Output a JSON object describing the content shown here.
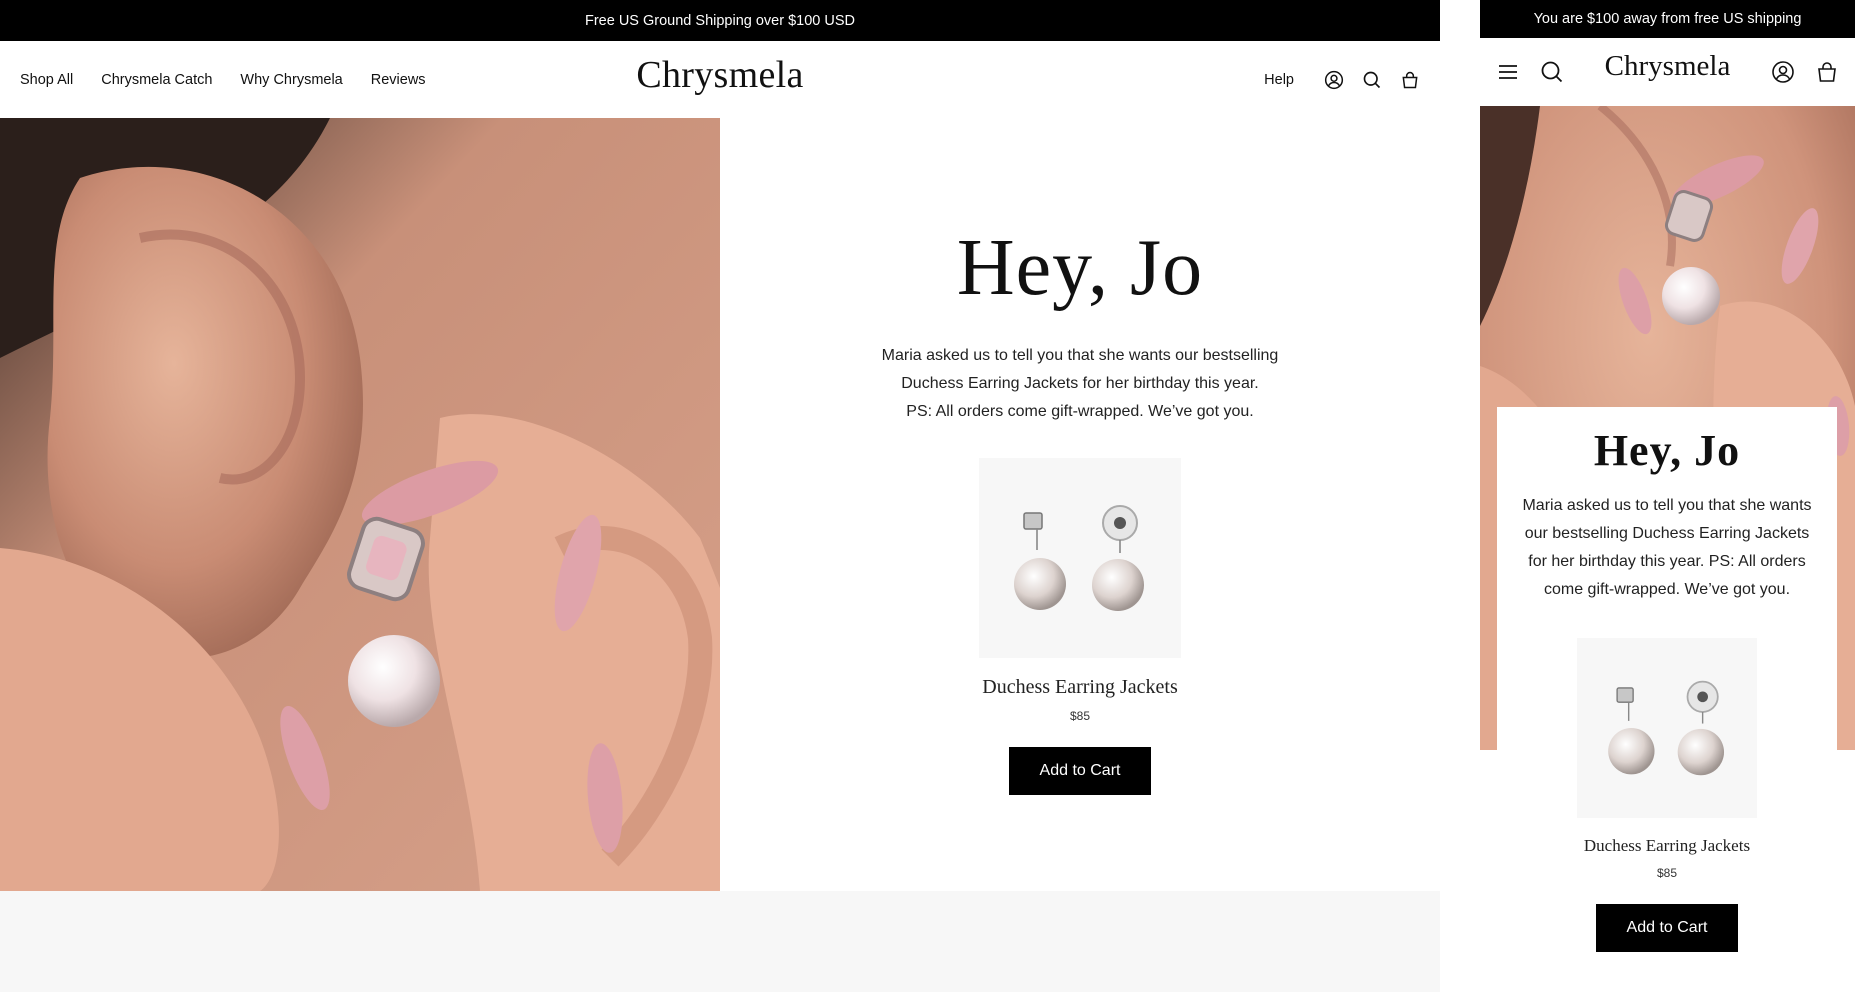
{
  "desktop": {
    "announcement": "Free US Ground Shipping over $100 USD",
    "nav": [
      "Shop All",
      "Chrysmela Catch",
      "Why Chrysmela",
      "Reviews"
    ],
    "logo": "Chrysmela",
    "help": "Help",
    "hero": {
      "greeting": "Hey, Jo",
      "message_lines": [
        "Maria asked us to tell you that she wants our bestselling",
        "Duchess Earring Jackets for her birthday this year.",
        "PS: All orders come gift-wrapped. We’ve got you."
      ],
      "product_name": "Duchess Earring Jackets",
      "price": "$85",
      "cta": "Add to Cart"
    }
  },
  "mobile": {
    "announcement": "You are $100 away from free US shipping",
    "logo": "Chrysmela",
    "greeting": "Hey, Jo",
    "message": "Maria asked us to tell you that she wants our bestselling Duchess Earring Jackets for her birthday this year. PS: All orders come gift-wrapped. We’ve got you.",
    "product_name": "Duchess Earring Jackets",
    "price": "$85",
    "cta": "Add to Cart"
  },
  "icons": {
    "account": "account-icon",
    "search": "search-icon",
    "cart": "bag-icon",
    "menu": "hamburger-menu-icon"
  },
  "colors": {
    "announcement_bg": "#000000",
    "button_bg": "#000000",
    "page_bg": "#f7f7f7",
    "nail_pink": "#e8a3ab"
  }
}
